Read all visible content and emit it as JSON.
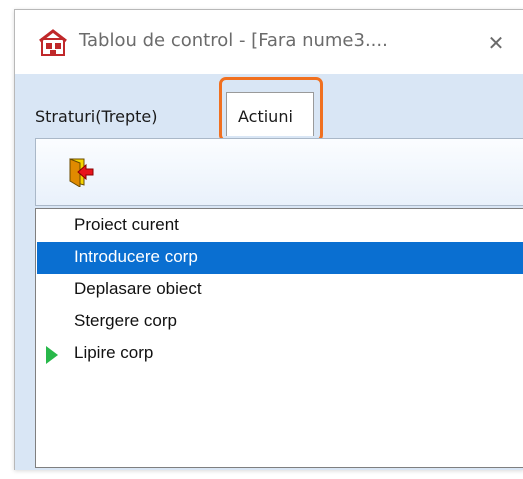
{
  "window": {
    "title": "Tablou de control - [Fara nume3....",
    "app_icon": "app-house-icon",
    "close_icon": "close-icon",
    "close_glyph": "✕"
  },
  "tabs": [
    {
      "label": "Straturi(Trepte)",
      "active": false
    },
    {
      "label": "Actiuni",
      "active": true
    }
  ],
  "highlight_color": "#f07020",
  "toolbar": {
    "buttons": [
      {
        "icon": "exit-arrow-icon"
      }
    ]
  },
  "list": {
    "items": [
      {
        "label": "Proiect curent",
        "selected": false,
        "marker": false
      },
      {
        "label": "Introducere corp",
        "selected": true,
        "marker": false
      },
      {
        "label": "Deplasare obiect",
        "selected": false,
        "marker": false
      },
      {
        "label": "Stergere corp",
        "selected": false,
        "marker": false
      },
      {
        "label": "Lipire corp",
        "selected": false,
        "marker": true
      }
    ],
    "selection_color": "#0a6fd1",
    "marker_icon": "play-arrow-icon",
    "marker_color": "#28b84a"
  }
}
